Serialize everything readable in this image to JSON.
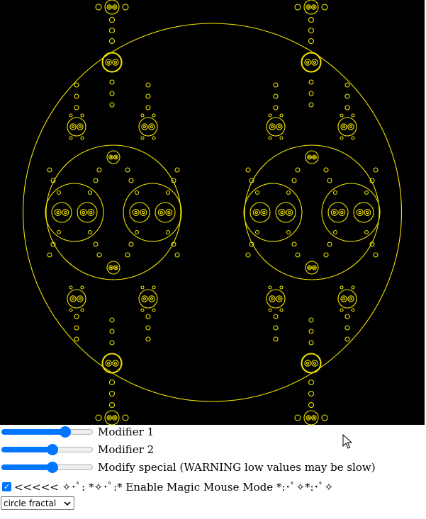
{
  "canvas": {
    "background": "#000000",
    "stroke_color": "#f2e500"
  },
  "controls": {
    "sliders": [
      {
        "label": "Modifier 1",
        "value": 0.73
      },
      {
        "label": "Modifier 2",
        "value": 0.57
      },
      {
        "label": "Modify special (WARNING low values may be slow)",
        "value": 0.57
      }
    ],
    "magic_mouse": {
      "checked": true,
      "label": "<<<<< ✧･ﾟ: *✧･ﾟ:* Enable Magic Mouse Mode *:･ﾟ✧*:･ﾟ✧"
    },
    "fractal_select": {
      "selected": "circle fractal"
    }
  },
  "icons": {
    "dropdown": "chevron-down-icon",
    "checkmark": "checkmark-icon",
    "cursor": "mouse-pointer-icon"
  },
  "accent_color": "#0075ff"
}
